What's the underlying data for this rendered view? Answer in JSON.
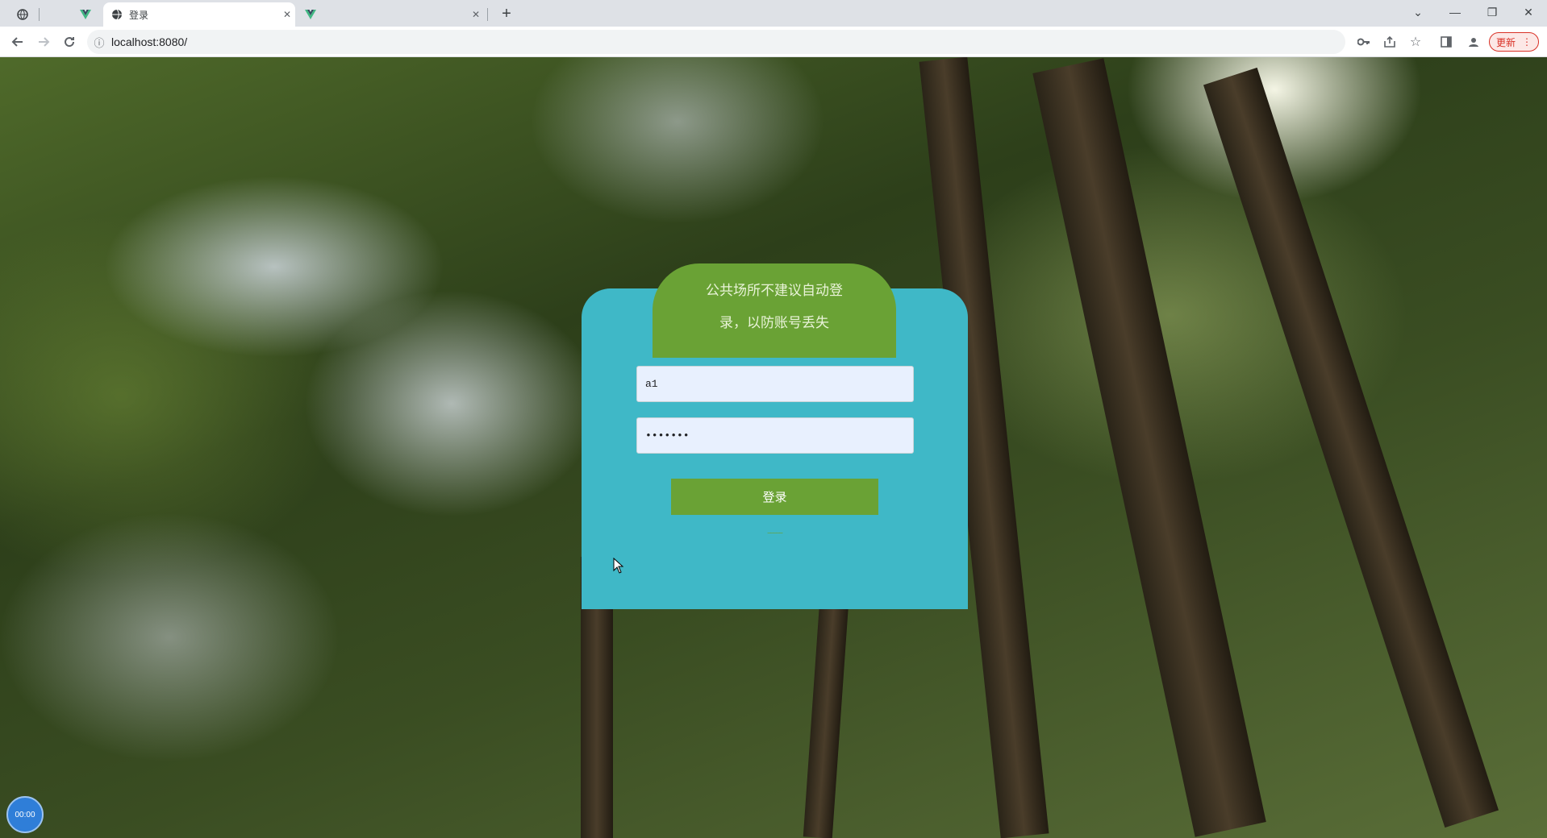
{
  "browser": {
    "tabs": [
      {
        "title": "",
        "favicon": "globe-icon",
        "pinned": true
      },
      {
        "title": "",
        "favicon": "vue-icon",
        "pinned": true
      },
      {
        "title": "登录",
        "favicon": "globe-icon",
        "active": true
      },
      {
        "title": "",
        "favicon": "vue-icon"
      }
    ],
    "new_tab_label": "+",
    "url": "localhost:8080/",
    "update_label": "更新"
  },
  "login": {
    "notice_text": "公共场所不建议自动登录，以防账号丢失",
    "username_value": "a1",
    "password_value": "•••••••",
    "login_button": "登录"
  },
  "timer_badge": "00:00",
  "colors": {
    "card": "#3fb8c7",
    "accent_green": "#6aa235",
    "input_bg": "#e8f0fe"
  }
}
